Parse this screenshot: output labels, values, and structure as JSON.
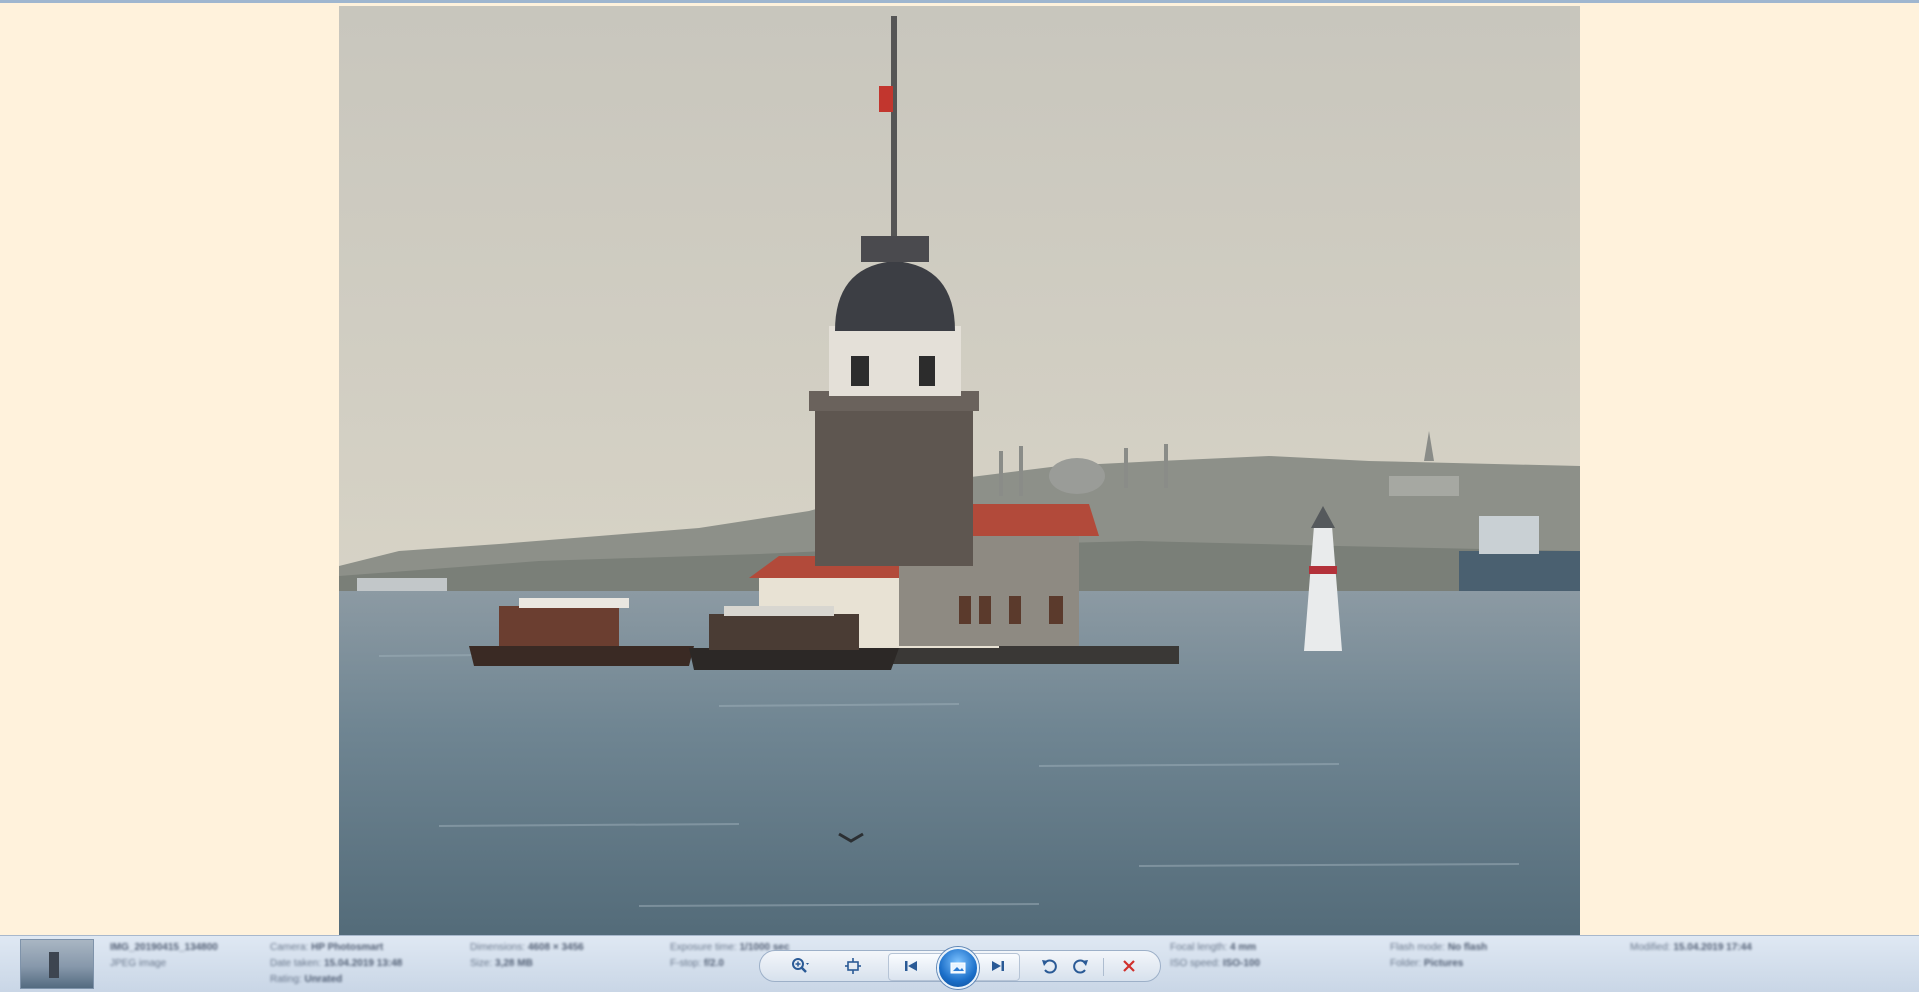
{
  "viewer": {
    "background": "#fff2dc",
    "photo_alt": "Maiden's Tower photo"
  },
  "file": {
    "name": "IMG_20190415_134800",
    "type": "JPEG image"
  },
  "details": [
    {
      "label": "Camera:",
      "value": "HP Photosmart"
    },
    {
      "label": "Date taken:",
      "value": "15.04.2019 13:48"
    },
    {
      "label": "Rating:",
      "value": "Unrated"
    },
    {
      "label": "Dimensions:",
      "value": "4608 × 3456"
    },
    {
      "label": "Size:",
      "value": "3,28 MB"
    },
    {
      "label": "Exposure time:",
      "value": "1/1000 sec"
    },
    {
      "label": "F-stop:",
      "value": "f/2.0"
    },
    {
      "label": "Focal length:",
      "value": "4 mm"
    },
    {
      "label": "ISO speed:",
      "value": "ISO-100"
    },
    {
      "label": "Flash mode:",
      "value": "No flash"
    },
    {
      "label": "Folder:",
      "value": "Pictures"
    },
    {
      "label": "Modified:",
      "value": "15.04.2019 17:44"
    }
  ],
  "controls": {
    "zoom": "zoom-icon",
    "actual_size": "fit-to-window-icon",
    "previous": "previous-icon",
    "slideshow": "slideshow-icon",
    "next": "next-icon",
    "rotate_ccw": "rotate-left-icon",
    "rotate_cw": "rotate-right-icon",
    "delete": "delete-icon"
  }
}
